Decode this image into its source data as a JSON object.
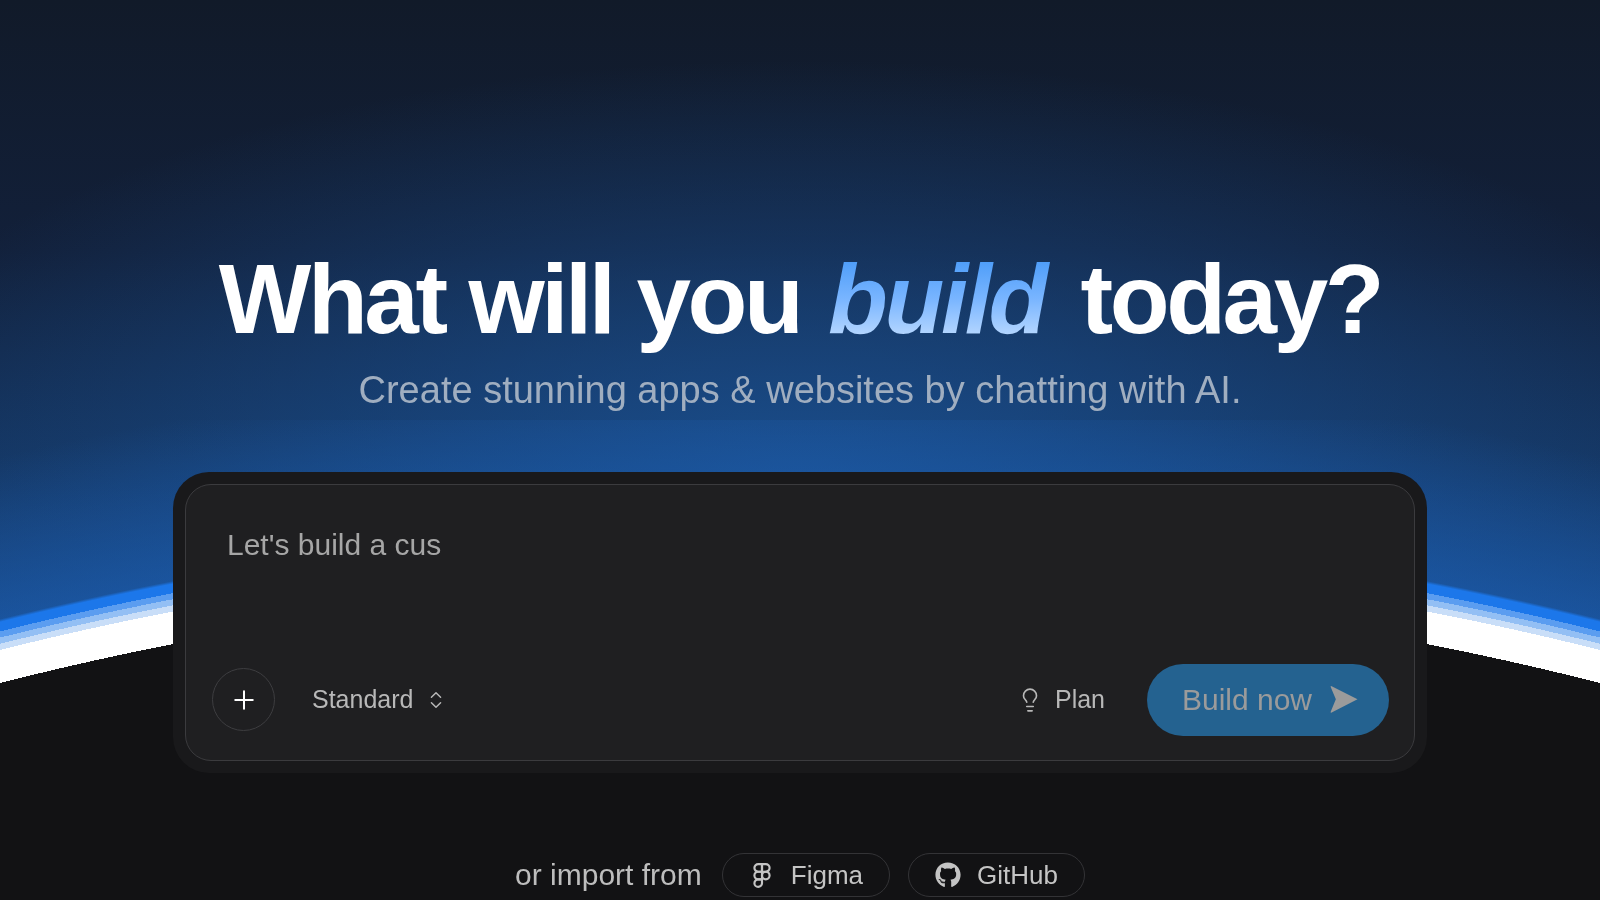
{
  "hero": {
    "title": "What will you *build* today?",
    "subtitle": "Create stunning apps & websites by chatting with AI."
  },
  "prompt": {
    "placeholder": "Let's build a cus",
    "mode": {
      "label": "Standard"
    },
    "plan": {
      "label": "Plan"
    },
    "submit": {
      "label": "Build now",
      "disabled": true
    }
  },
  "import": {
    "label": "or import from",
    "sources": [
      {
        "kind": "figma",
        "label": "Figma"
      },
      {
        "kind": "github",
        "label": "GitHub"
      }
    ]
  }
}
